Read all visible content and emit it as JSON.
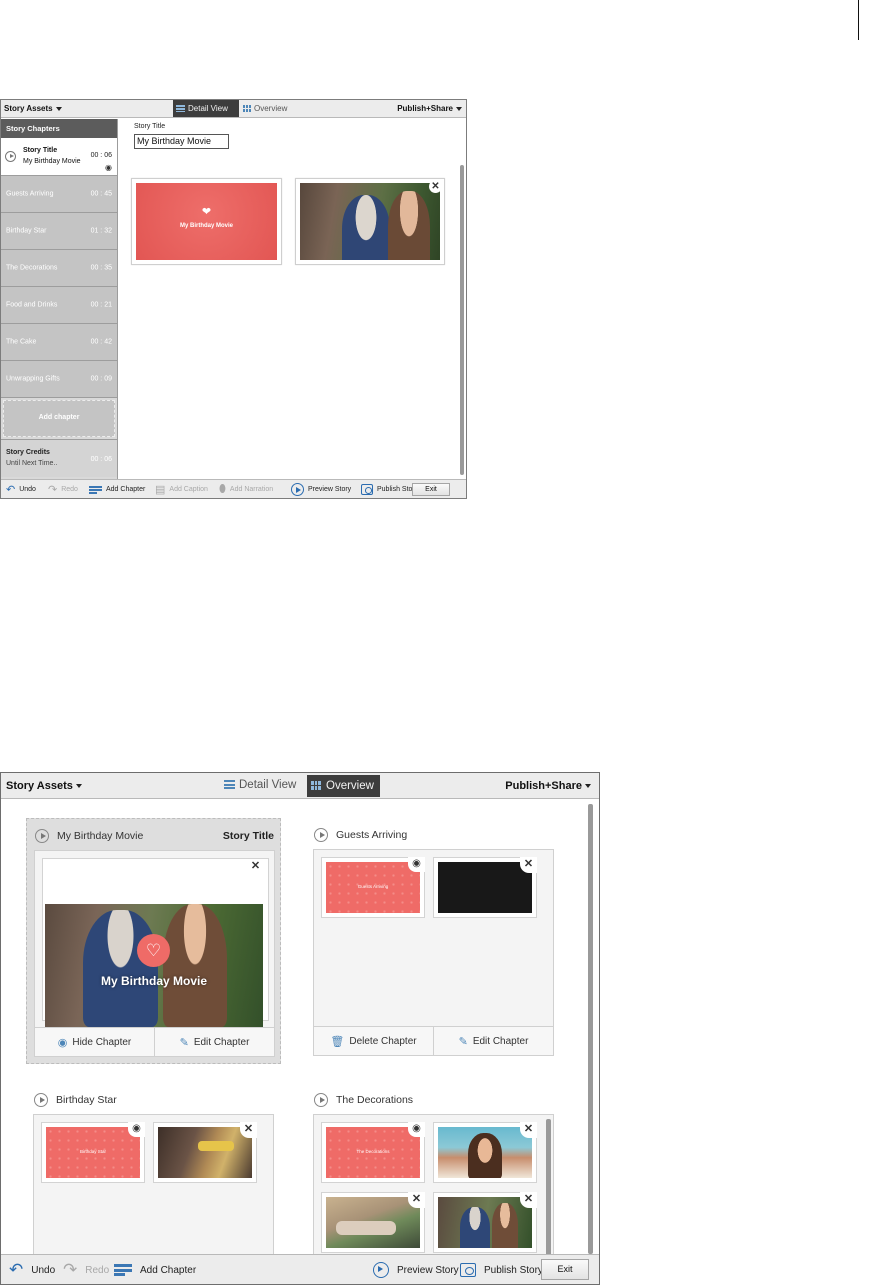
{
  "detail_window": {
    "toolbar": {
      "assets_menu": "Story Assets",
      "tab_detail": "Detail View",
      "tab_overview": "Overview",
      "publish_menu": "Publish+Share"
    },
    "chapters_header": "Story Chapters",
    "selected_chapter": {
      "title": "Story Title",
      "subtitle": "My Birthday Movie",
      "duration": "00 : 06"
    },
    "chapters": [
      {
        "name": "Guests Arriving",
        "duration": "00 : 45"
      },
      {
        "name": "Birthday Star",
        "duration": "01 : 32"
      },
      {
        "name": "The Decorations",
        "duration": "00 : 35"
      },
      {
        "name": "Food and Drinks",
        "duration": "00 : 21"
      },
      {
        "name": "The Cake",
        "duration": "00 : 42"
      },
      {
        "name": "Unwrapping Gifts",
        "duration": "00 : 09"
      }
    ],
    "add_chapter": "Add chapter",
    "credits": {
      "title": "Story Credits",
      "subtitle": "Until Next Time..",
      "duration": "00 : 06"
    },
    "story_title_label": "Story Title",
    "story_title_value": "My Birthday Movie",
    "title_card_text": "My Birthday Movie",
    "bottom": {
      "undo": "Undo",
      "redo": "Redo",
      "add_chapter": "Add Chapter",
      "add_caption": "Add Caption",
      "add_narration": "Add Narration",
      "preview": "Preview Story",
      "publish": "Publish Story",
      "exit": "Exit"
    }
  },
  "overview_window": {
    "toolbar": {
      "assets_menu": "Story Assets",
      "tab_detail": "Detail View",
      "tab_overview": "Overview",
      "publish_menu": "Publish+Share"
    },
    "cards": [
      {
        "name": "My Birthday Movie",
        "tag": "Story Title",
        "photo_title": "My Birthday Movie",
        "action_left": "Hide Chapter",
        "action_right": "Edit Chapter"
      },
      {
        "name": "Guests Arriving",
        "thumb_text": "Guests Arriving",
        "action_left": "Delete Chapter",
        "action_right": "Edit Chapter"
      },
      {
        "name": "Birthday Star",
        "thumb_text": "Birthday Star"
      },
      {
        "name": "The Decorations",
        "thumb_text": "The Decorations"
      }
    ],
    "bottom": {
      "undo": "Undo",
      "redo": "Redo",
      "add_chapter": "Add Chapter",
      "preview": "Preview Story",
      "publish": "Publish Story",
      "exit": "Exit"
    }
  },
  "colors": {
    "accent": "#4d86b8",
    "title_card": "#ef6b67",
    "active_tab": "#3d3d3d",
    "chapter_row": "#c4c4c4"
  }
}
